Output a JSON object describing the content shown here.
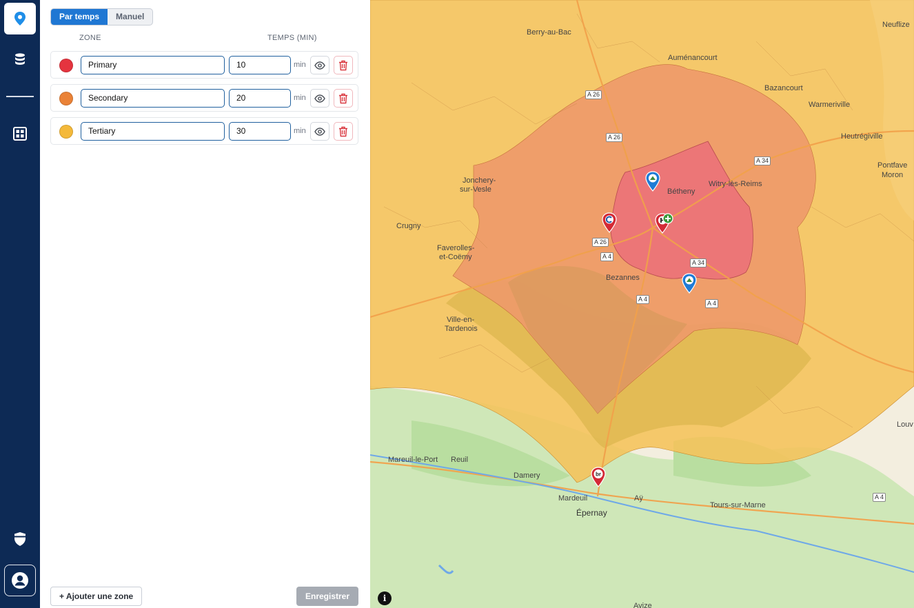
{
  "nav": {
    "items": [
      {
        "icon": "map-pin-icon",
        "active": true
      },
      {
        "icon": "database-icon",
        "active": false
      },
      {
        "icon": "dashboard-grid-icon",
        "active": false
      }
    ],
    "bottom": [
      {
        "icon": "shield-icon"
      },
      {
        "icon": "user-profile-icon"
      }
    ]
  },
  "panel": {
    "mode_tabs": [
      {
        "label": "Par temps",
        "active": true
      },
      {
        "label": "Manuel",
        "active": false
      }
    ],
    "columns": {
      "zone": "ZONE",
      "time": "TEMPS (MIN)"
    },
    "zones": [
      {
        "name": "Primary",
        "time": "10",
        "unit": "min",
        "color": "#e5343f"
      },
      {
        "name": "Secondary",
        "time": "20",
        "unit": "min",
        "color": "#ea8237"
      },
      {
        "name": "Tertiary",
        "time": "30",
        "unit": "min",
        "color": "#f4b93a"
      }
    ],
    "add_button": "+ Ajouter une zone",
    "save_button": "Enregistrer"
  },
  "map": {
    "labels": {
      "berry": "Berry-au-Bac",
      "aumenancourt": "Auménancourt",
      "bazancourt": "Bazancourt",
      "warmeriville": "Warmeriville",
      "heutregiville": "Heutrégiville",
      "pontfaverger": "Pontfave",
      "moronvilliers": "Moron",
      "neuflize": "Neuflize",
      "jonchery1": "Jonchery-",
      "jonchery2": "sur-Vesle",
      "bethany": "Bétheny",
      "witry": "Witry-lès-Reims",
      "crugny": "Crugny",
      "faverolles1": "Faverolles-",
      "faverolles2": "et-Coëmy",
      "bezannes": "Bezannes",
      "ville1": "Ville-en-",
      "ville2": "Tardenois",
      "mareuil_port": "Mareuil-le-Port",
      "reuil": "Reuil",
      "damery": "Damery",
      "mardeuil": "Mardeuil",
      "epernay": "Épernay",
      "ay": "Aÿ",
      "tours": "Tours-sur-Marne",
      "avize": "Avize",
      "louvois": "Louv"
    },
    "roads": [
      "A 26",
      "A 26",
      "A 34",
      "A 26",
      "A 4",
      "A 34",
      "A 4",
      "A 4",
      "A 4"
    ],
    "info": "i"
  }
}
